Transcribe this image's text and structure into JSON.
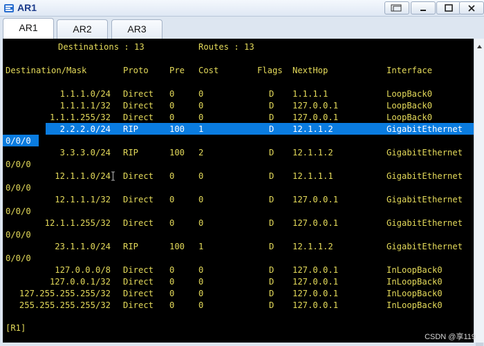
{
  "window": {
    "title": "AR1"
  },
  "tabs": [
    {
      "label": "AR1",
      "active": true
    },
    {
      "label": "AR2",
      "active": false
    },
    {
      "label": "AR3",
      "active": false
    }
  ],
  "terminal": {
    "summary": {
      "destinations": "Destinations : 13",
      "routes": "Routes : 13"
    },
    "headers": {
      "destination": "Destination/Mask",
      "proto": "Proto",
      "pre": "Pre",
      "cost": "Cost",
      "flags": "Flags",
      "nexthop": "NextHop",
      "interface": "Interface"
    },
    "rows": [
      {
        "dest": "1.1.1.0/24",
        "proto": "Direct",
        "pre": "0",
        "cost": "0",
        "flags": "D",
        "nexthop": "1.1.1.1",
        "iface": "LoopBack0",
        "cont": ""
      },
      {
        "dest": "1.1.1.1/32",
        "proto": "Direct",
        "pre": "0",
        "cost": "0",
        "flags": "D",
        "nexthop": "127.0.0.1",
        "iface": "LoopBack0",
        "cont": ""
      },
      {
        "dest": "1.1.1.255/32",
        "proto": "Direct",
        "pre": "0",
        "cost": "0",
        "flags": "D",
        "nexthop": "127.0.0.1",
        "iface": "LoopBack0",
        "cont": ""
      },
      {
        "dest": "2.2.2.0/24",
        "proto": "RIP",
        "pre": "100",
        "cost": "1",
        "flags": "D",
        "nexthop": "12.1.1.2",
        "iface": "GigabitEthernet",
        "cont": "0/0/0"
      },
      {
        "dest": "3.3.3.0/24",
        "proto": "RIP",
        "pre": "100",
        "cost": "2",
        "flags": "D",
        "nexthop": "12.1.1.2",
        "iface": "GigabitEthernet",
        "cont": "0/0/0"
      },
      {
        "dest": "12.1.1.0/24",
        "proto": "Direct",
        "pre": "0",
        "cost": "0",
        "flags": "D",
        "nexthop": "12.1.1.1",
        "iface": "GigabitEthernet",
        "cont": "0/0/0"
      },
      {
        "dest": "12.1.1.1/32",
        "proto": "Direct",
        "pre": "0",
        "cost": "0",
        "flags": "D",
        "nexthop": "127.0.0.1",
        "iface": "GigabitEthernet",
        "cont": "0/0/0"
      },
      {
        "dest": "12.1.1.255/32",
        "proto": "Direct",
        "pre": "0",
        "cost": "0",
        "flags": "D",
        "nexthop": "127.0.0.1",
        "iface": "GigabitEthernet",
        "cont": "0/0/0"
      },
      {
        "dest": "23.1.1.0/24",
        "proto": "RIP",
        "pre": "100",
        "cost": "1",
        "flags": "D",
        "nexthop": "12.1.1.2",
        "iface": "GigabitEthernet",
        "cont": "0/0/0"
      },
      {
        "dest": "127.0.0.0/8",
        "proto": "Direct",
        "pre": "0",
        "cost": "0",
        "flags": "D",
        "nexthop": "127.0.0.1",
        "iface": "InLoopBack0",
        "cont": ""
      },
      {
        "dest": "127.0.0.1/32",
        "proto": "Direct",
        "pre": "0",
        "cost": "0",
        "flags": "D",
        "nexthop": "127.0.0.1",
        "iface": "InLoopBack0",
        "cont": ""
      },
      {
        "dest": "127.255.255.255/32",
        "proto": "Direct",
        "pre": "0",
        "cost": "0",
        "flags": "D",
        "nexthop": "127.0.0.1",
        "iface": "InLoopBack0",
        "cont": ""
      },
      {
        "dest": "255.255.255.255/32",
        "proto": "Direct",
        "pre": "0",
        "cost": "0",
        "flags": "D",
        "nexthop": "127.0.0.1",
        "iface": "InLoopBack0",
        "cont": ""
      }
    ],
    "prompt": "[R1]"
  },
  "watermark": "CSDN @享119",
  "colors": {
    "terminal_bg": "#000000",
    "terminal_text": "#e4da5a",
    "highlight": "#0a7ce0",
    "title_text": "#1a3a8a"
  }
}
